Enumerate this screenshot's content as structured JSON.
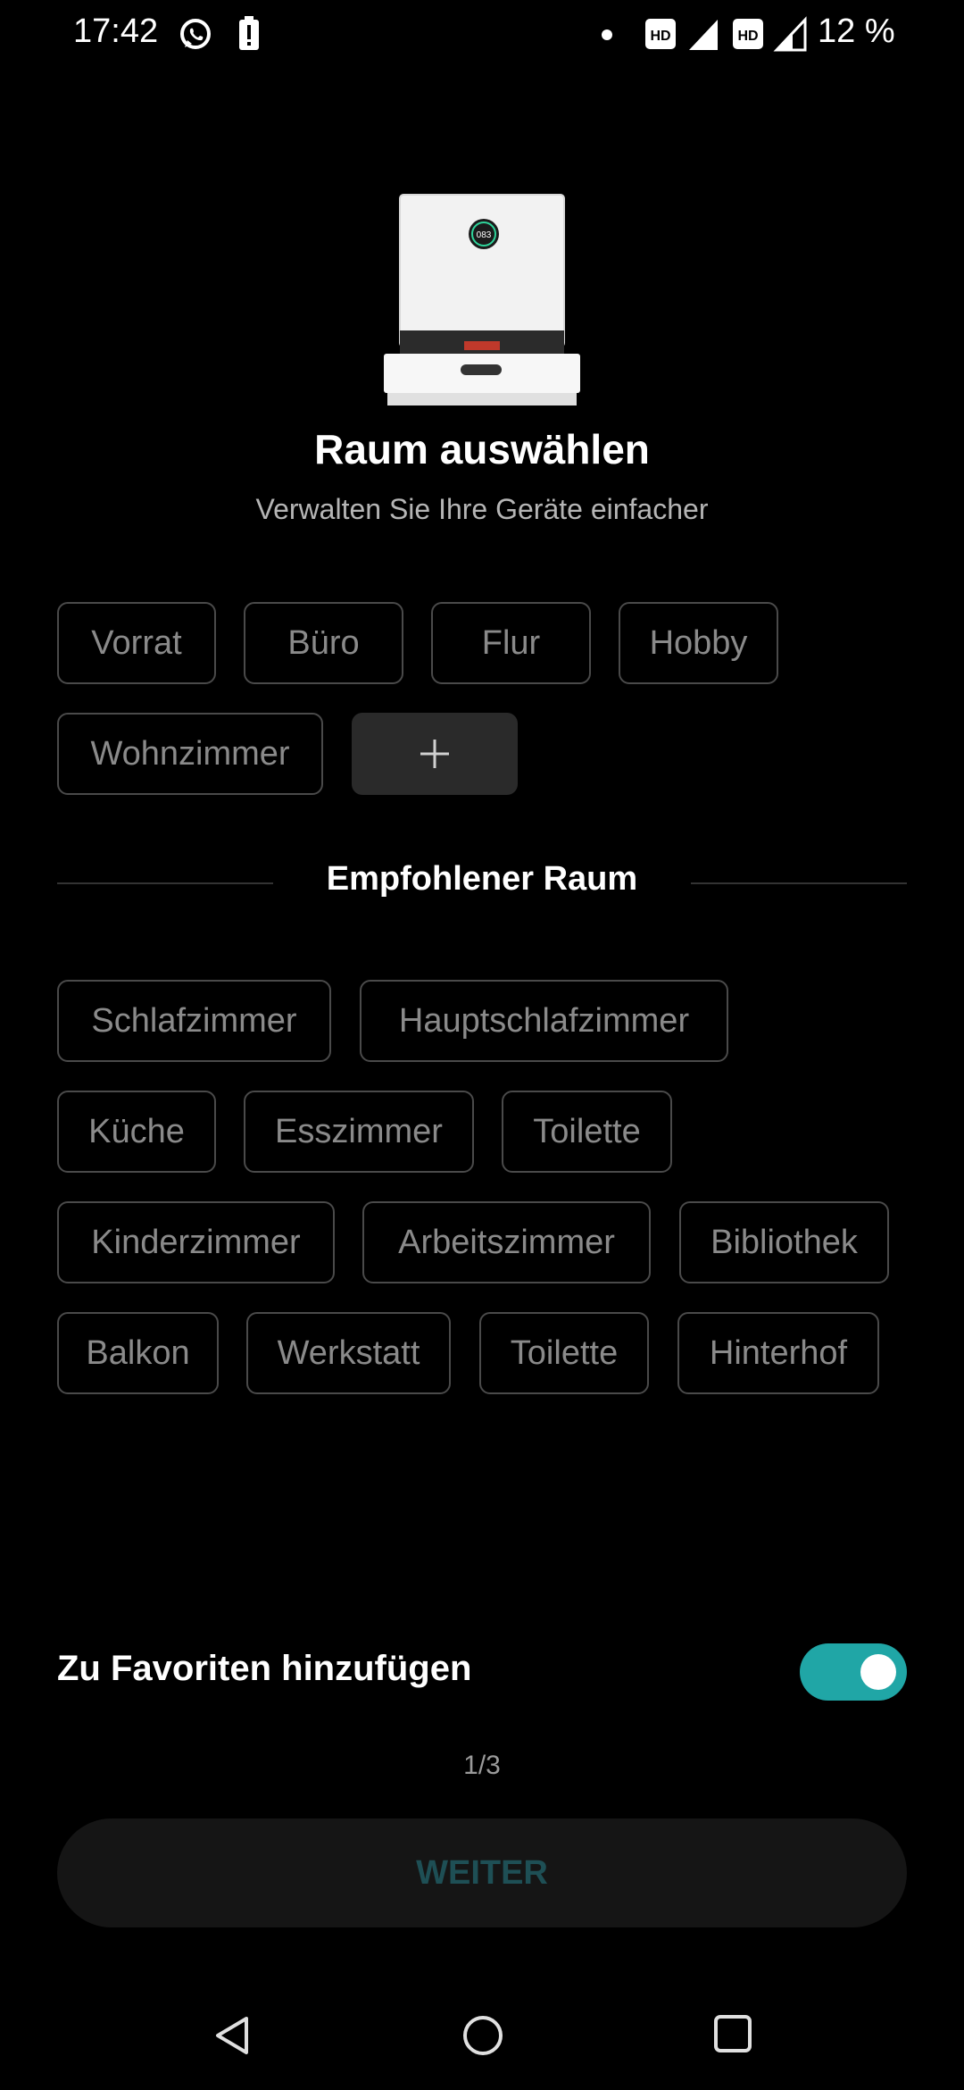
{
  "status_bar": {
    "time": "17:42",
    "battery_percent": "12 %",
    "icons": [
      "whatsapp-icon",
      "alert-icon",
      "dot-icon",
      "hd-icon",
      "signal-icon",
      "hd-icon",
      "signal-icon"
    ]
  },
  "header": {
    "title": "Raum auswählen",
    "subtitle": "Verwalten Sie Ihre Geräte einfacher"
  },
  "rooms": [
    "Vorrat",
    "Büro",
    "Flur",
    "Hobby",
    "Wohnzimmer"
  ],
  "add_button": {
    "icon": "plus-icon"
  },
  "recommended": {
    "title": "Empfohlener Raum",
    "rooms": [
      "Schlafzimmer",
      "Hauptschlafzimmer",
      "Küche",
      "Esszimmer",
      "Toilette",
      "Kinderzimmer",
      "Arbeitszimmer",
      "Bibliothek",
      "Balkon",
      "Werkstatt",
      "Toilette",
      "Hinterhof"
    ]
  },
  "favorites": {
    "label": "Zu Favoriten hinzufügen",
    "enabled": true
  },
  "page_indicator": "1/3",
  "next_button": "WEITER",
  "colors": {
    "accent": "#20a6a6",
    "button_text": "#1e4f55",
    "background": "#000000"
  },
  "nav_bar": {
    "icons": [
      "back-icon",
      "home-icon",
      "recents-icon"
    ]
  }
}
